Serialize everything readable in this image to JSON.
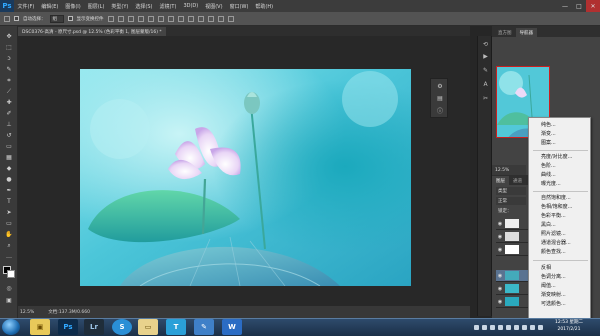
{
  "app": {
    "logo": "Ps"
  },
  "menubar": {
    "items": [
      "文件(F)",
      "编辑(E)",
      "图像(I)",
      "图层(L)",
      "类型(Y)",
      "选择(S)",
      "滤镜(T)",
      "3D(D)",
      "视图(V)",
      "窗口(W)",
      "帮助(H)"
    ],
    "window_controls": [
      "—",
      "□",
      "✕"
    ]
  },
  "options": {
    "auto_select_label": "自动选择：",
    "auto_select_value": "组",
    "transform_label": "显示变换控件"
  },
  "document": {
    "tab_title": "DSC0376-高清 - 原尺寸.psd @ 12.5% (色彩平衡 1, 图层蒙版/16) *"
  },
  "navigator": {
    "tabs": [
      "直方图",
      "导航器"
    ],
    "zoom": "12.5%"
  },
  "layers": {
    "tabs": [
      "图层",
      "通道"
    ],
    "kind_label": "类型",
    "blend_mode": "正常",
    "lock_label": "锁定："
  },
  "status": {
    "zoom": "12.5%",
    "doc_size": "文档:137.3M/0.660"
  },
  "context_menu": {
    "groups": [
      [
        "纯色...",
        "渐变...",
        "图案..."
      ],
      [
        "亮度/对比度...",
        "色阶...",
        "曲线...",
        "曝光度..."
      ],
      [
        "自然饱和度...",
        "色相/饱和度...",
        "色彩平衡...",
        "黑白...",
        "照片滤镜...",
        "通道混合器...",
        "颜色查找..."
      ],
      [
        "反相",
        "色调分离...",
        "阈值...",
        "渐变映射...",
        "可选颜色..."
      ]
    ]
  },
  "taskbar": {
    "apps": [
      "Ps",
      "Lr",
      "S",
      "T"
    ],
    "clock_time": "12:53 星期二",
    "clock_date": "2017/2/21"
  },
  "colors": {
    "menubar": "#3c3c3c",
    "panel": "#434343",
    "canvas_bg": "#282828",
    "accent": "#30a8ff"
  }
}
